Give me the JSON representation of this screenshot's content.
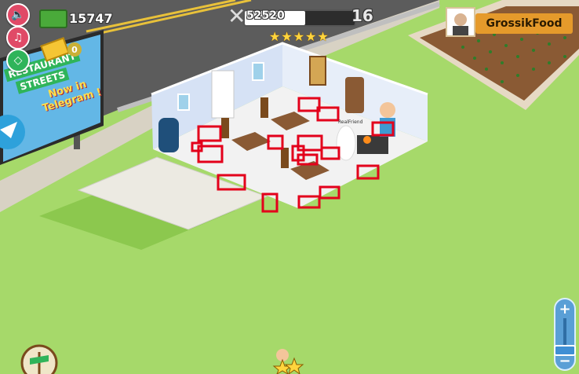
{
  "hud": {
    "coins": "15747",
    "zero_badge": "0",
    "xp": "52520",
    "level": "16",
    "xp_progress": 0.55,
    "stars": 5
  },
  "profile": {
    "name": "GrossikFood"
  },
  "billboard": {
    "line1": "RESTAURANT",
    "line2": "STREETS",
    "line3": "Now in",
    "line4": "Telegram !"
  },
  "world": {
    "npc_label": "RealFriend"
  },
  "zoom": {
    "plus": "+",
    "minus": "−",
    "level": 0.2
  },
  "colors": {
    "grass": "#a6d96a",
    "road": "#5f5f5f",
    "floor": "#f0f0f0",
    "wall": "#d6e2f5",
    "highlight": "#e3001b",
    "accent": "#e59a2b"
  },
  "icons": [
    "sound-icon",
    "music-icon",
    "settings-icon",
    "cash-icon",
    "gold-icon",
    "fork-knife-icon",
    "telegram-icon",
    "plate-icon",
    "compass-icon",
    "hand-star-icon"
  ]
}
